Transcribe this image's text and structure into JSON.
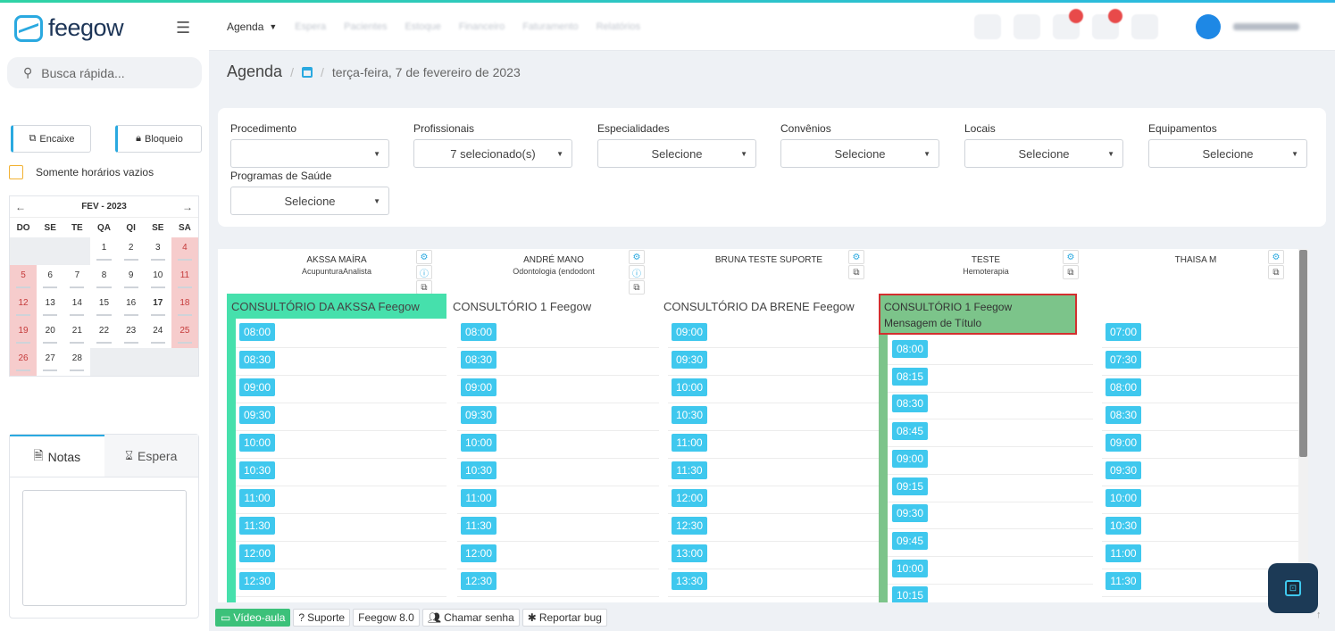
{
  "app": {
    "logo_text": "feegow"
  },
  "topnav": {
    "agenda_label": "Agenda",
    "blurred_items": [
      "Espera",
      "Pacientes",
      "Estoque",
      "Financeiro",
      "Faturamento",
      "Relatórios"
    ]
  },
  "sidebar": {
    "search_placeholder": "Busca rápida...",
    "encaixe_label": "Encaixe",
    "bloqueio_label": "Bloqueio",
    "only_empty_label": "Somente horários vazios",
    "calendar": {
      "month_label": "FEV - 2023",
      "dows": [
        "DO",
        "SE",
        "TE",
        "QA",
        "QI",
        "SE",
        "SA"
      ],
      "weeks": [
        [
          "",
          "",
          "",
          "1",
          "2",
          "3",
          "4"
        ],
        [
          "5",
          "6",
          "7",
          "8",
          "9",
          "10",
          "11"
        ],
        [
          "12",
          "13",
          "14",
          "15",
          "16",
          "17",
          "18"
        ],
        [
          "19",
          "20",
          "21",
          "22",
          "23",
          "24",
          "25"
        ],
        [
          "26",
          "27",
          "28",
          "",
          "",
          "",
          ""
        ]
      ]
    },
    "notes_tab": "Notas",
    "wait_tab": "Espera"
  },
  "breadcrumb": {
    "title": "Agenda",
    "date": "terça-feira, 7 de fevereiro de 2023"
  },
  "filters": {
    "procedimento": {
      "label": "Procedimento",
      "value": ""
    },
    "profissionais": {
      "label": "Profissionais",
      "value": "7 selecionado(s)"
    },
    "especialidades": {
      "label": "Especialidades",
      "value": "Selecione"
    },
    "convenios": {
      "label": "Convênios",
      "value": "Selecione"
    },
    "locais": {
      "label": "Locais",
      "value": "Selecione"
    },
    "equipamentos": {
      "label": "Equipamentos",
      "value": "Selecione"
    },
    "programas": {
      "label": "Programas de Saúde",
      "value": "Selecione"
    }
  },
  "columns": [
    {
      "name": "AKSSA MAÍRA",
      "spec": "AcupunturaAnalista",
      "local": "CONSULTÓRIO DA AKSSA Feegow",
      "slots": [
        "08:00",
        "08:30",
        "09:00",
        "09:30",
        "10:00",
        "10:30",
        "11:00",
        "11:30",
        "12:00",
        "12:30"
      ]
    },
    {
      "name": "ANDRÉ MANO",
      "spec": "Odontologia (endodont",
      "local": "CONSULTÓRIO 1 Feegow",
      "slots": [
        "08:00",
        "08:30",
        "09:00",
        "09:30",
        "10:00",
        "10:30",
        "11:00",
        "11:30",
        "12:00",
        "12:30"
      ]
    },
    {
      "name": "BRUNA TESTE SUPORTE",
      "spec": "",
      "local": "CONSULTÓRIO DA BRENE Feegow",
      "slots": [
        "09:00",
        "09:30",
        "10:00",
        "10:30",
        "11:00",
        "11:30",
        "12:00",
        "12:30",
        "13:00",
        "13:30"
      ]
    },
    {
      "name": "TESTE",
      "spec": "Hemoterapia",
      "local": "CONSULTÓRIO 1 Feegow",
      "message": "Mensagem de Título",
      "slots": [
        "08:00",
        "08:15",
        "08:30",
        "08:45",
        "09:00",
        "09:15",
        "09:30",
        "09:45",
        "10:00",
        "10:15"
      ]
    },
    {
      "name": "THAISA M",
      "spec": "",
      "local": "",
      "slots": [
        "07:00",
        "07:30",
        "08:00",
        "08:30",
        "09:00",
        "09:30",
        "10:00",
        "10:30",
        "11:00",
        "11:30"
      ]
    }
  ],
  "footer": {
    "video": "Vídeo-aula",
    "suporte": "Suporte",
    "version": "Feegow 8.0",
    "chamar": "Chamar senha",
    "bug": "Reportar bug"
  },
  "colors": {
    "accent": "#2aa9e0",
    "slot": "#3fc8ee",
    "local_green": "#46e0ac",
    "weekend": "#f6cccc"
  }
}
